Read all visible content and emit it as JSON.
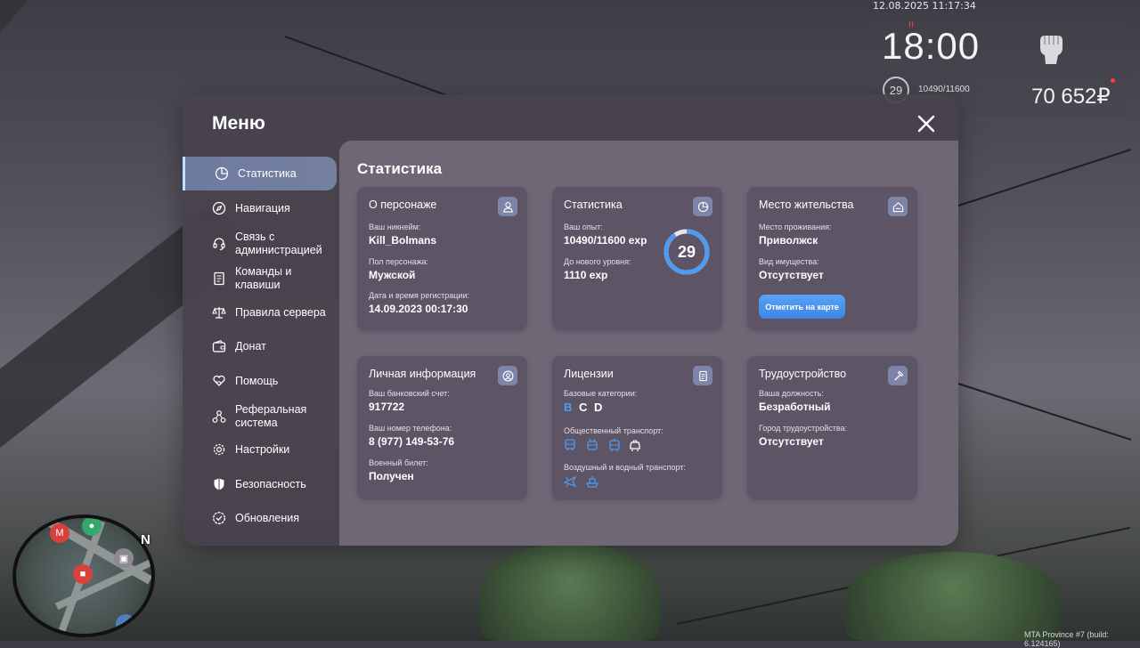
{
  "hud": {
    "datetime": "12.08.2025 11:17:34",
    "clock": "18:00",
    "alert_mark": "!!",
    "level": "29",
    "exp": "10490/11600",
    "money": "70 652₽"
  },
  "minimap": {
    "north": "N"
  },
  "build_info": "MTA Province #7 (build: 6.124165)",
  "menu": {
    "title": "Меню",
    "nav": [
      {
        "label": "Статистика",
        "icon": "pie-chart-icon",
        "active": true
      },
      {
        "label": "Навигация",
        "icon": "compass-icon"
      },
      {
        "label": "Связь с администрацией",
        "icon": "headset-icon"
      },
      {
        "label": "Команды и клавиши",
        "icon": "document-icon"
      },
      {
        "label": "Правила сервера",
        "icon": "scales-icon"
      },
      {
        "label": "Донат",
        "icon": "wallet-icon"
      },
      {
        "label": "Помощь",
        "icon": "heart-hand-icon"
      },
      {
        "label": "Реферальная система",
        "icon": "network-icon"
      },
      {
        "label": "Настройки",
        "icon": "gear-icon"
      },
      {
        "label": "Безопасность",
        "icon": "shield-icon"
      },
      {
        "label": "Обновления",
        "icon": "check-badge-icon"
      }
    ],
    "content_title": "Статистика",
    "cards": {
      "character": {
        "title": "О персонаже",
        "nickname_label": "Ваш никнейм:",
        "nickname": "Kill_Bolmans",
        "gender_label": "Пол персонажа:",
        "gender": "Мужской",
        "reg_label": "Дата и время регистрации:",
        "reg": "14.09.2023 00:17:30"
      },
      "stats": {
        "title": "Статистика",
        "exp_label": "Ваш опыт:",
        "exp": "10490/11600 exp",
        "next_label": "До нового уровня:",
        "next": "1110 exp",
        "level": "29",
        "level_progress": 0.904
      },
      "residence": {
        "title": "Место жительства",
        "place_label": "Место проживания:",
        "place": "Приволжск",
        "property_label": "Вид имущества:",
        "property": "Отсутствует",
        "button": "Отметить на карте"
      },
      "personal": {
        "title": "Личная информация",
        "bank_label": "Ваш банковский счет:",
        "bank": "917722",
        "phone_label": "Ваш номер телефона:",
        "phone": "8 (977) 149-53-76",
        "military_label": "Военный билет:",
        "military": "Получен"
      },
      "licenses": {
        "title": "Лицензии",
        "base_label": "Базовые категории:",
        "categories": [
          "B",
          "C",
          "D"
        ],
        "public_label": "Общественный транспорт:",
        "air_label": "Воздушный и водный транспорт:"
      },
      "employment": {
        "title": "Трудоустройство",
        "position_label": "Ваша должность:",
        "position": "Безработный",
        "city_label": "Город трудоустройства:",
        "city": "Отсутствует"
      }
    }
  },
  "colors": {
    "accent": "#4d9cf2",
    "active_nav": "#6e7aa0",
    "license_active": "#4d9cf2"
  }
}
